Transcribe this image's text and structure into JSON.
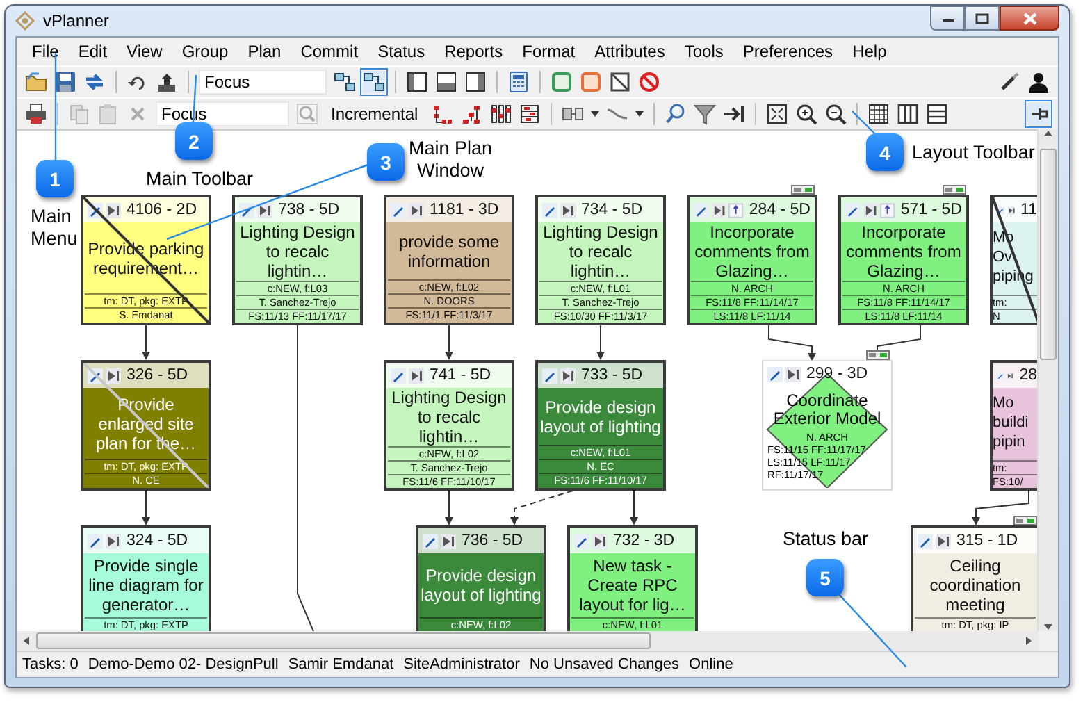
{
  "window": {
    "title": "vPlanner"
  },
  "menu": [
    "File",
    "Edit",
    "View",
    "Group",
    "Plan",
    "Commit",
    "Status",
    "Reports",
    "Format",
    "Attributes",
    "Tools",
    "Preferences",
    "Help"
  ],
  "main_toolbar": {
    "focus_field": {
      "value": "Focus"
    }
  },
  "layout_toolbar": {
    "focus_field": {
      "value": "Focus"
    },
    "mode_button": "Incremental"
  },
  "plan_cards": [
    {
      "kind": "task",
      "id_label": "4106 - 2D",
      "title": "Provide parking requirement…",
      "details": [
        "tm: DT, pkg: EXTP",
        "S. Emdanat"
      ],
      "color": "#ffff80",
      "crossed": true,
      "pinned": false,
      "linked": false
    },
    {
      "kind": "task",
      "id_label": "738 - 5D",
      "title": "Lighting Design to recalc lightin…",
      "details": [
        "c:NEW, f:L03",
        "T. Sanchez-Trejo",
        "FS:11/13 FF:11/17/17"
      ],
      "color": "#c4f5bc",
      "crossed": false,
      "pinned": false,
      "linked": false
    },
    {
      "kind": "task",
      "id_label": "1181 - 3D",
      "title": "provide some information",
      "details": [
        "c:NEW, f:L02",
        "N. DOORS",
        "FS:11/1 FF:11/3/17"
      ],
      "color": "#d2b997",
      "crossed": false,
      "pinned": false,
      "linked": false
    },
    {
      "kind": "task",
      "id_label": "734 - 5D",
      "title": "Lighting Design to recalc lightin…",
      "details": [
        "c:NEW, f:L01",
        "T. Sanchez-Trejo",
        "FS:10/30 FF:11/3/17"
      ],
      "color": "#c4f5bc",
      "crossed": false,
      "pinned": false,
      "linked": false
    },
    {
      "kind": "task",
      "id_label": "284 - 5D",
      "title": "Incorporate comments from Glazing…",
      "details": [
        "N. ARCH",
        "FS:11/8 FF:11/14/17",
        "LS:11/8 LF:11/14"
      ],
      "color": "#80f080",
      "crossed": false,
      "pinned": true,
      "linked": true
    },
    {
      "kind": "task",
      "id_label": "571 - 5D",
      "title": "Incorporate comments from Glazing…",
      "details": [
        "N. ARCH",
        "FS:11/8 FF:11/14/17",
        "LS:11/8 LF:11/14"
      ],
      "color": "#80f080",
      "crossed": false,
      "pinned": true,
      "linked": true
    },
    {
      "kind": "task",
      "id_label": "11",
      "title": "Mo Ov piping",
      "details": [
        "tm:",
        "N"
      ],
      "color": "#ddf3f1",
      "crossed": true,
      "pinned": false,
      "linked": false
    },
    {
      "kind": "task",
      "id_label": "326 - 5D",
      "title": "Provide enlarged site plan for the…",
      "details": [
        "tm: DT, pkg: EXTP",
        "N. CE"
      ],
      "color": "#808000",
      "crossed": true,
      "pinned": false,
      "linked": false
    },
    {
      "kind": "task",
      "id_label": "741 - 5D",
      "title": "Lighting Design to recalc lightin…",
      "details": [
        "c:NEW, f:L02",
        "T. Sanchez-Trejo",
        "FS:11/6 FF:11/10/17"
      ],
      "color": "#c4f5bc",
      "crossed": false,
      "pinned": false,
      "linked": false
    },
    {
      "kind": "task",
      "id_label": "733 - 5D",
      "title": "Provide design layout of lighting",
      "details": [
        "c:NEW, f:L01",
        "N. EC",
        "FS:11/6 FF:11/10/17"
      ],
      "color": "#3b8a3b",
      "crossed": false,
      "pinned": false,
      "linked": false
    },
    {
      "kind": "milestone",
      "id_label": "299 - 3D",
      "title": "Coordinate Exterior Model",
      "details": [
        "N. ARCH",
        "FS:11/15 FF:11/17/17",
        "LS:11/15 LF:11/17",
        "RF:11/17/17"
      ],
      "color": "#80f080",
      "crossed": false,
      "pinned": false,
      "linked": true
    },
    {
      "kind": "task",
      "id_label": "28",
      "title": "Mo buildi pipin",
      "details": [
        "tm:",
        "FS:10/"
      ],
      "color": "#e8c3dc",
      "crossed": false,
      "pinned": false,
      "linked": false
    },
    {
      "kind": "task",
      "id_label": "324 - 5D",
      "title": "Provide single line diagram for generator…",
      "details": [
        "tm: DT, pkg: EXTP"
      ],
      "color": "#a6fcd8",
      "crossed": false,
      "pinned": false,
      "linked": false
    },
    {
      "kind": "task",
      "id_label": "736 - 5D",
      "title": "Provide design layout of lighting",
      "details": [
        "c:NEW, f:L02"
      ],
      "color": "#3b8a3b",
      "crossed": false,
      "pinned": false,
      "linked": false
    },
    {
      "kind": "task",
      "id_label": "732 - 3D",
      "title": "New task - Create RPC layout for lig…",
      "details": [
        "c:NEW, f:L01"
      ],
      "color": "#80f080",
      "crossed": false,
      "pinned": false,
      "linked": false
    },
    {
      "kind": "task",
      "id_label": "315 - 1D",
      "title": "Ceiling coordination meeting",
      "details": [
        "tm: DT, pkg: IP"
      ],
      "color": "#f1ede2",
      "crossed": false,
      "pinned": false,
      "linked": true
    }
  ],
  "callouts": [
    {
      "number": "1",
      "label": "Main Menu"
    },
    {
      "number": "2",
      "label": "Main Toolbar"
    },
    {
      "number": "3",
      "label": "Main Plan Window"
    },
    {
      "number": "4",
      "label": "Layout Toolbar"
    },
    {
      "number": "5",
      "label": "Status bar"
    }
  ],
  "status_bar": [
    "Tasks: 0",
    "Demo-Demo 02- DesignPull",
    "Samir Emdanat",
    "SiteAdministrator",
    "No Unsaved Changes",
    "Online"
  ]
}
